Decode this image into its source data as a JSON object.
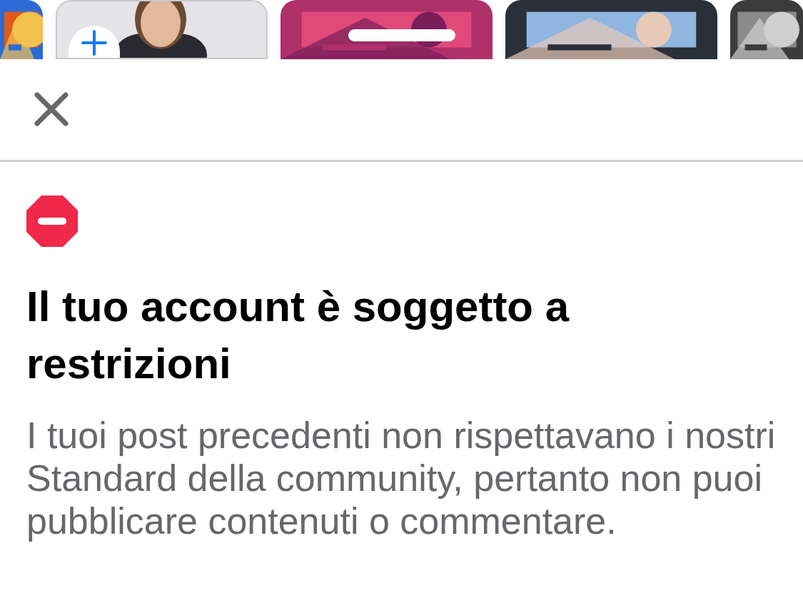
{
  "stories": [
    {
      "kind": "picture"
    },
    {
      "kind": "add"
    },
    {
      "kind": "picture"
    },
    {
      "kind": "picture"
    },
    {
      "kind": "picture"
    }
  ],
  "sheet": {
    "title": "Il tuo account è soggetto a restrizioni",
    "message": "I tuoi post precedenti non rispettavano i nostri Standard della community, pertanto non puoi pubblicare contenuti o commentare."
  }
}
